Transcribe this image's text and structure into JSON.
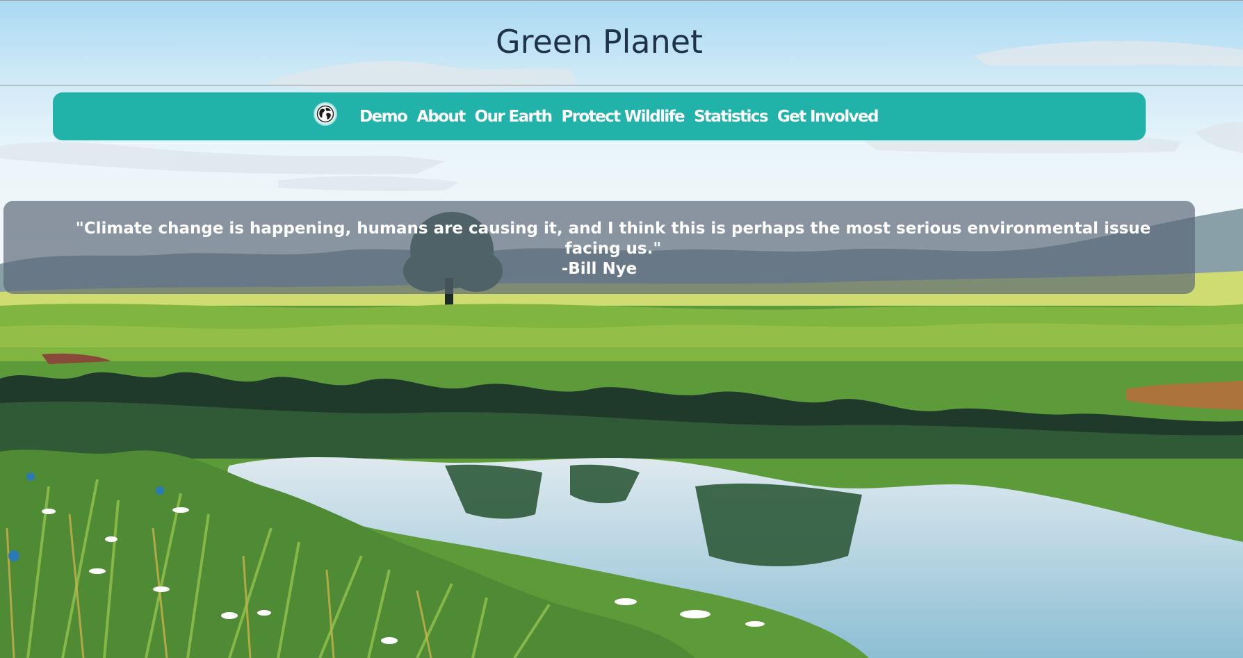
{
  "header": {
    "title": "Green Planet"
  },
  "nav": {
    "logo_icon": "globe-icon",
    "links": [
      {
        "label": "Demo"
      },
      {
        "label": "About"
      },
      {
        "label": "Our Earth"
      },
      {
        "label": "Protect Wildlife"
      },
      {
        "label": "Statistics"
      },
      {
        "label": "Get Involved"
      }
    ]
  },
  "quote": {
    "text": "\"Climate change is happening, humans are causing it, and I think this is perhaps the most serious environmental issue facing us.\"",
    "author": "-Bill Nye"
  },
  "colors": {
    "nav_background": "#21b2aa",
    "title_text": "#1f3348",
    "quote_panel": "#586676"
  }
}
